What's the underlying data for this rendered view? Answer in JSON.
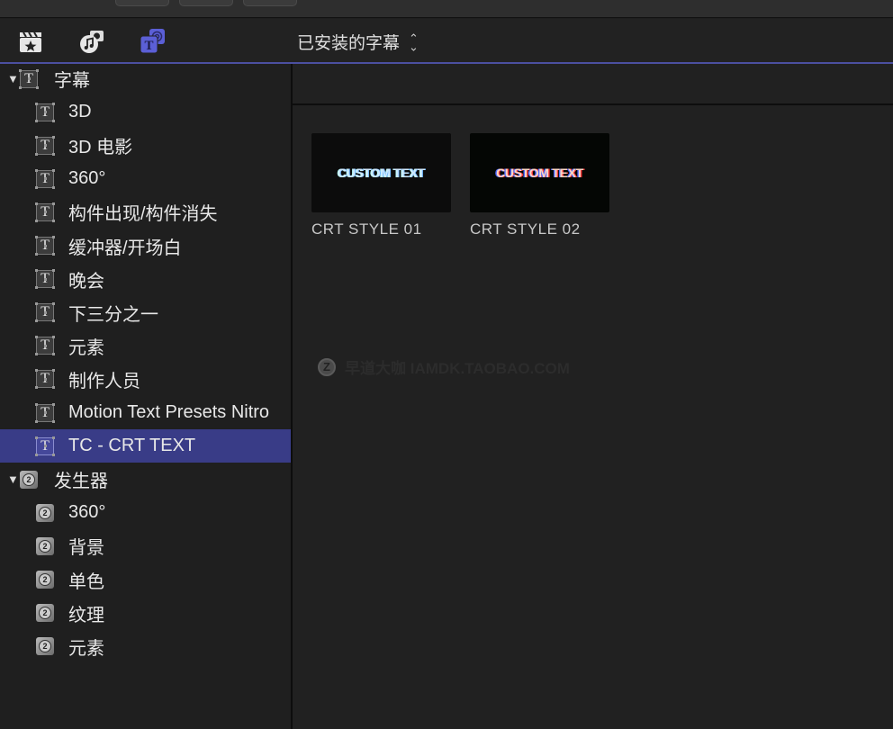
{
  "toolbar": {
    "library_icon": "clapperboard-star-icon",
    "audio_photo_icon": "music-photo-icon",
    "titles_generators_icon": "titles-generators-icon",
    "browser_title": "已安装的字幕",
    "accent_color": "#4b4fa0"
  },
  "sidebar": {
    "groups": [
      {
        "label": "字幕",
        "icon": "title-T-icon",
        "expanded": true,
        "items": [
          {
            "label": "3D"
          },
          {
            "label": "3D 电影"
          },
          {
            "label": "360°"
          },
          {
            "label": "构件出现/构件消失"
          },
          {
            "label": "缓冲器/开场白"
          },
          {
            "label": "晚会"
          },
          {
            "label": "下三分之一"
          },
          {
            "label": "元素"
          },
          {
            "label": "制作人员"
          },
          {
            "label": "Motion Text Presets Nitro"
          },
          {
            "label": "TC - CRT TEXT",
            "selected": true
          }
        ]
      },
      {
        "label": "发生器",
        "icon": "generator-icon",
        "expanded": true,
        "items": [
          {
            "label": "360°"
          },
          {
            "label": "背景"
          },
          {
            "label": "单色"
          },
          {
            "label": "纹理"
          },
          {
            "label": "元素"
          }
        ]
      }
    ],
    "selected_color": "#393c87"
  },
  "main": {
    "thumbnails": [
      {
        "preview_text": "CUSTOM TEXT",
        "label": "CRT STYLE 01"
      },
      {
        "preview_text": "CUSTOM TEXT",
        "label": "CRT STYLE 02"
      }
    ],
    "watermark": {
      "logo_letter": "Z",
      "text": "早道大咖  IAMDK.TAOBAO.COM"
    }
  }
}
